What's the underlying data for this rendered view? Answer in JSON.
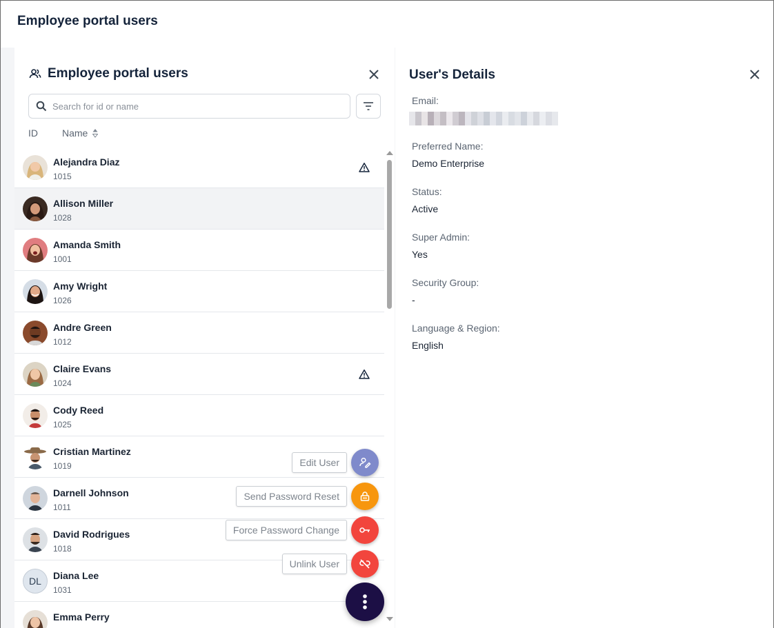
{
  "page": {
    "title": "Employee portal users"
  },
  "left_panel": {
    "title": "Employee portal users",
    "search_placeholder": "Search for id or name",
    "columns": {
      "id": "ID",
      "name": "Name"
    },
    "rows": [
      {
        "name": "Alejandra Diaz",
        "id": "1015",
        "warning": true,
        "avatar": "photo"
      },
      {
        "name": "Allison Miller",
        "id": "1028",
        "warning": false,
        "avatar": "photo",
        "selected": true
      },
      {
        "name": "Amanda Smith",
        "id": "1001",
        "warning": false,
        "avatar": "photo"
      },
      {
        "name": "Amy Wright",
        "id": "1026",
        "warning": false,
        "avatar": "photo"
      },
      {
        "name": "Andre Green",
        "id": "1012",
        "warning": false,
        "avatar": "photo"
      },
      {
        "name": "Claire Evans",
        "id": "1024",
        "warning": true,
        "avatar": "photo"
      },
      {
        "name": "Cody Reed",
        "id": "1025",
        "warning": false,
        "avatar": "photo"
      },
      {
        "name": "Cristian Martinez",
        "id": "1019",
        "warning": false,
        "avatar": "photo"
      },
      {
        "name": "Darnell Johnson",
        "id": "1011",
        "warning": false,
        "avatar": "photo"
      },
      {
        "name": "David Rodrigues",
        "id": "1018",
        "warning": false,
        "avatar": "photo"
      },
      {
        "name": "Diana Lee",
        "id": "1031",
        "warning": false,
        "avatar": "initials",
        "initials": "DL"
      },
      {
        "name": "Emma Perry",
        "id": "",
        "warning": false,
        "avatar": "photo"
      }
    ]
  },
  "fab_menu": {
    "edit_user": "Edit User",
    "send_password_reset": "Send Password Reset",
    "force_password_change": "Force Password Change",
    "unlink_user": "Unlink User",
    "colors": {
      "edit": "#7f8acb",
      "reset": "#f7960e",
      "force": "#f2453d",
      "unlink": "#f2453d",
      "main": "#1c0f45"
    }
  },
  "details": {
    "title": "User's Details",
    "email_label": "Email:",
    "preferred_name_label": "Preferred Name:",
    "preferred_name": "Demo Enterprise",
    "status_label": "Status:",
    "status": "Active",
    "super_admin_label": "Super Admin:",
    "super_admin": "Yes",
    "security_group_label": "Security Group:",
    "security_group": "-",
    "language_label": "Language & Region:",
    "language": "English"
  }
}
